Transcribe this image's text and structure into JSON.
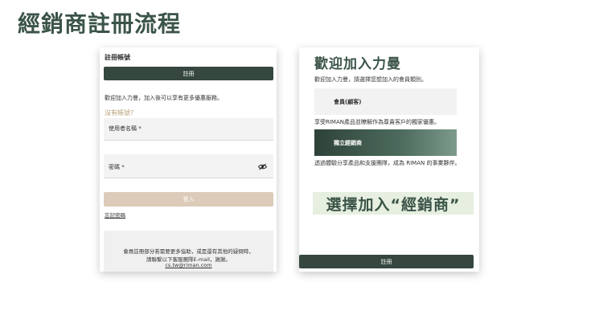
{
  "page": {
    "title": "經銷商註冊流程"
  },
  "left_panel": {
    "header": "註冊帳號",
    "register_button": "註冊",
    "welcome_text": "歡迎加入力曼，加入後可以享有更多優惠服務。",
    "no_account_text": "沒有帳號?",
    "username_label": "使用者名稱 *",
    "password_label": "密碼 *",
    "login_button": "登入",
    "forgot_password": "忘記密碼",
    "help_line1": "會員註冊部分若需要更多協助，或是還有其他的疑問時，",
    "help_line2": "請聯繫以下客服團隊E-mail，謝謝。",
    "help_email": "cs.tw@riman.com",
    "icons": {
      "password_toggle": "eye-off-icon"
    }
  },
  "right_panel": {
    "title": "歡迎加入力曼",
    "subtitle": "歡迎加入力曼，請選擇您想加入的會員類別。",
    "member_option": "會員(顧客)",
    "member_desc": "享受RIMAN產品並瞭解作為尊貴客戶的獨家優惠。",
    "distributor_option": "獨立經銷商",
    "distributor_desc": "透過體驗分享產品和支援團隊，成為 RIMAN 的事業夥伴。",
    "callout": "選擇加入“經銷商”",
    "register_button": "註冊"
  },
  "colors": {
    "brand_dark_green": "#35473f",
    "title_green": "#3b5448",
    "login_beige": "#dccbb9",
    "no_account_gold": "#b8a27a",
    "callout_bg": "#e6efe0"
  }
}
